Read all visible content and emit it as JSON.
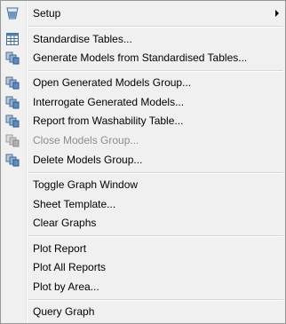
{
  "menu": {
    "items": [
      {
        "label": "Setup",
        "icon": "setup-glass-icon",
        "submenu": true,
        "enabled": true
      },
      {
        "label": "Standardise Tables...",
        "icon": "table-icon",
        "enabled": true
      },
      {
        "label": "Generate Models from Standardised Tables...",
        "icon": "models-icon",
        "enabled": true
      },
      {
        "label": "Open Generated Models Group...",
        "icon": "models-icon",
        "enabled": true
      },
      {
        "label": "Interrogate Generated Models...",
        "icon": "models-icon",
        "enabled": true
      },
      {
        "label": "Report from Washability Table...",
        "icon": "models-icon",
        "enabled": true
      },
      {
        "label": "Close Models Group...",
        "icon": "models-icon",
        "enabled": false
      },
      {
        "label": "Delete Models Group...",
        "icon": "models-icon",
        "enabled": true
      },
      {
        "label": "Toggle Graph Window",
        "enabled": true
      },
      {
        "label": "Sheet Template...",
        "enabled": true
      },
      {
        "label": "Clear Graphs",
        "enabled": true
      },
      {
        "label": "Plot Report",
        "enabled": true
      },
      {
        "label": "Plot All Reports",
        "enabled": true
      },
      {
        "label": "Plot by Area...",
        "enabled": true
      },
      {
        "label": "Query Graph",
        "enabled": true
      }
    ]
  },
  "colors": {
    "background": "#f0f0f0",
    "disabled_text": "#8d8d8d",
    "icon_blue": "#4a7fb5",
    "icon_gray": "#9a9a9a"
  }
}
